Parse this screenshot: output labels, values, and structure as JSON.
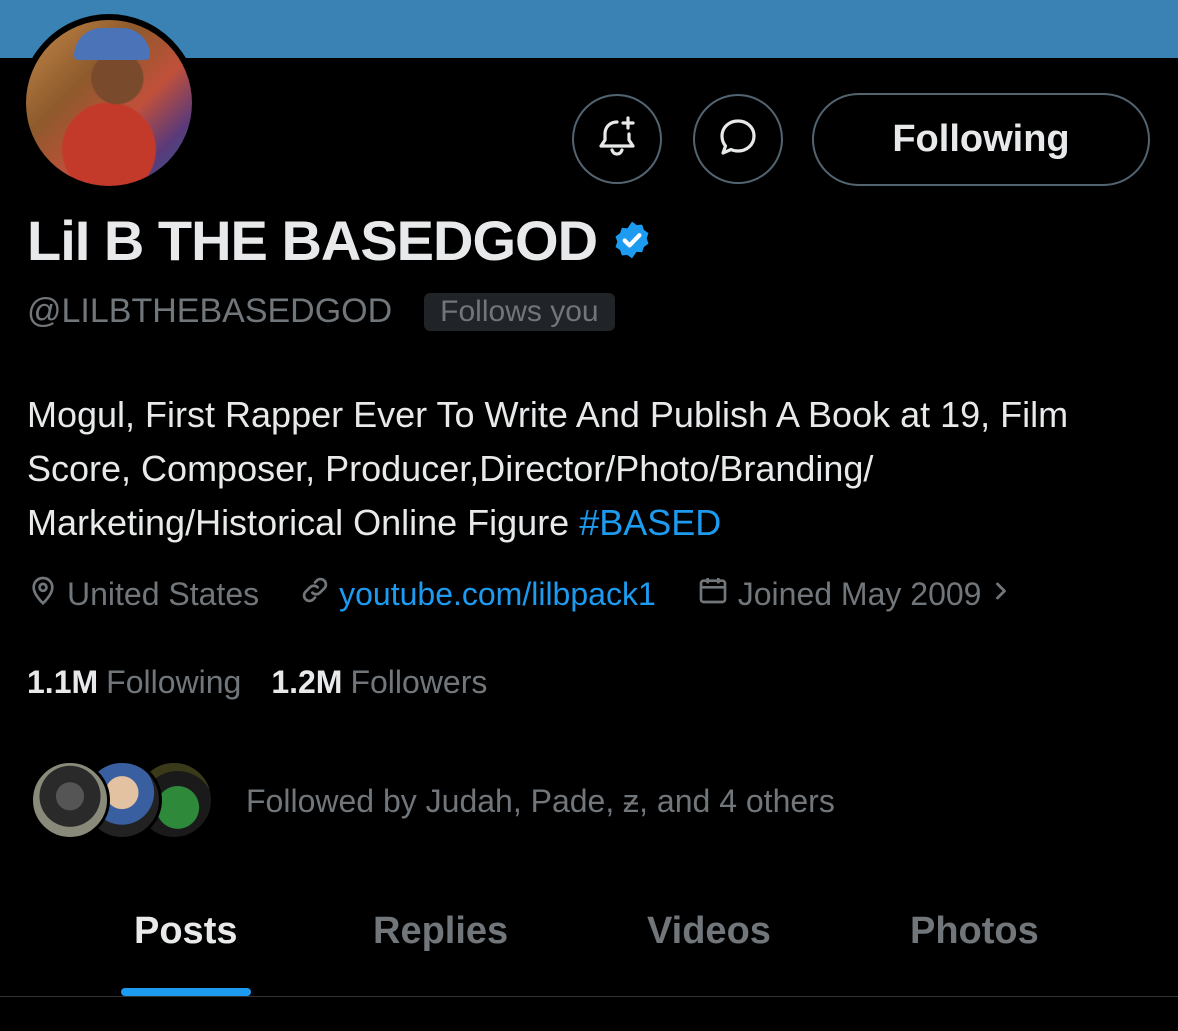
{
  "profile": {
    "name": "LiI B THE BASEDGOD",
    "handle": "@LILBTHEBASEDGOD",
    "follows_you": "Follows you",
    "bio_text": "Mogul, First Rapper Ever To Write And Publish A Book at 19, Film Score, Composer, Producer,Director/Photo/Branding/ Marketing/Historical Online Figure ",
    "bio_hashtag": "#BASED",
    "location": "United States",
    "website": "youtube.com/lilbpack1",
    "joined": "Joined May 2009"
  },
  "actions": {
    "following_label": "Following",
    "notify_icon": "bell-plus-icon",
    "message_icon": "message-bubble-icon"
  },
  "stats": {
    "following_count": "1.1M",
    "following_label": "Following",
    "followers_count": "1.2M",
    "followers_label": "Followers"
  },
  "followed_by": "Followed by Judah, Pade, ƶ, and 4 others",
  "tabs": [
    {
      "label": "Posts",
      "active": true
    },
    {
      "label": "Replies",
      "active": false
    },
    {
      "label": "Videos",
      "active": false
    },
    {
      "label": "Photos",
      "active": false
    }
  ],
  "colors": {
    "banner": "#3a82b4",
    "accent": "#1d9bf0",
    "background": "#000000",
    "muted": "#71767b"
  }
}
